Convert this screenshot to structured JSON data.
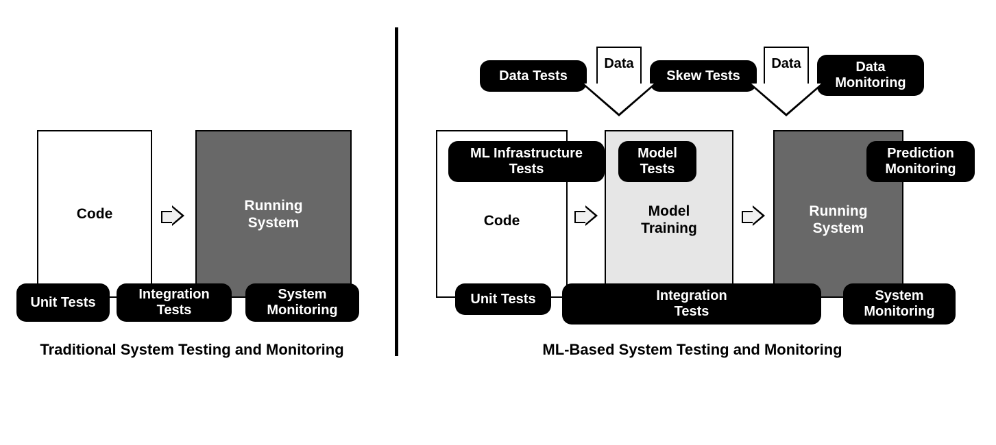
{
  "left": {
    "code": "Code",
    "running": "Running\nSystem",
    "unit": "Unit Tests",
    "integration": "Integration\nTests",
    "sysmon": "System\nMonitoring",
    "caption": "Traditional System Testing and Monitoring"
  },
  "right": {
    "data1": "Data",
    "data2": "Data",
    "dataTests": "Data Tests",
    "skewTests": "Skew Tests",
    "dataMon": "Data\nMonitoring",
    "mlInfra": "ML Infrastructure\nTests",
    "modelTests": "Model\nTests",
    "predMon": "Prediction\nMonitoring",
    "code": "Code",
    "modelTraining": "Model\nTraining",
    "running": "Running\nSystem",
    "unit": "Unit Tests",
    "integration": "Integration\nTests",
    "sysmon": "System\nMonitoring",
    "caption": "ML-Based System Testing and Monitoring"
  }
}
